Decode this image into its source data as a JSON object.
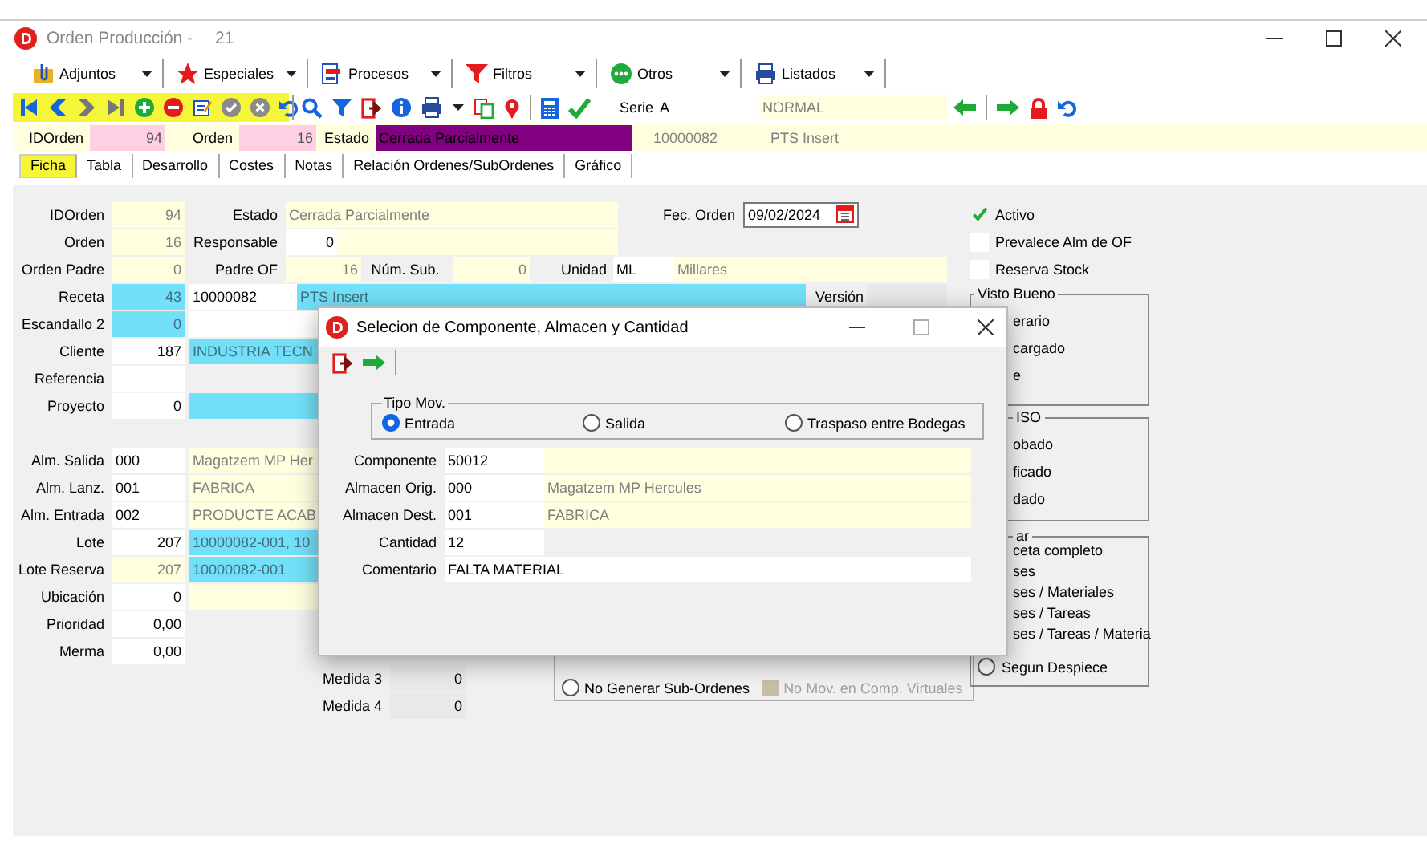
{
  "window": {
    "title": "Orden Producción -",
    "number": "21"
  },
  "menu_toolbar": [
    {
      "label": "Adjuntos"
    },
    {
      "label": "Especiales"
    },
    {
      "label": "Procesos"
    },
    {
      "label": "Filtros"
    },
    {
      "label": "Otros"
    },
    {
      "label": "Listados"
    }
  ],
  "serie": {
    "label": "Serie",
    "value": "A",
    "description": "NORMAL"
  },
  "header": [
    {
      "kind": "label",
      "text": "IDOrden"
    },
    {
      "kind": "key",
      "text": "94"
    },
    {
      "kind": "label",
      "text": "Orden"
    },
    {
      "kind": "key",
      "text": "16"
    },
    {
      "kind": "label",
      "text": "Estado"
    },
    {
      "kind": "status",
      "text": "Cerrada Parcialmente",
      "color": "#800080"
    },
    {
      "kind": "readonly",
      "text": "10000082"
    },
    {
      "kind": "readonly",
      "text": "PTS Insert"
    }
  ],
  "tabs": [
    {
      "label": "Ficha",
      "selected": true
    },
    {
      "label": "Tabla",
      "selected": false
    },
    {
      "label": "Desarrollo",
      "selected": false
    },
    {
      "label": "Costes",
      "selected": false
    },
    {
      "label": "Notas",
      "selected": false
    },
    {
      "label": "Relación Ordenes/SubOrdenes",
      "selected": false
    },
    {
      "label": "Gráfico",
      "selected": false
    }
  ],
  "form_rows": [
    [
      {
        "kind": "label",
        "text": "IDOrden"
      },
      {
        "kind": "readonly",
        "text": "94"
      },
      {
        "kind": "label",
        "text": "Estado"
      },
      {
        "kind": "readonly",
        "text": "Cerrada Parcialmente"
      },
      {
        "kind": "label",
        "text": "Fec. Orden"
      },
      {
        "kind": "date",
        "text": "09/02/2024"
      }
    ],
    [
      {
        "kind": "label",
        "text": "Orden"
      },
      {
        "kind": "readonly",
        "text": "16"
      },
      {
        "kind": "label",
        "text": "Responsable"
      },
      {
        "kind": "input",
        "text": "0"
      },
      {
        "kind": "readonly"
      }
    ],
    [
      {
        "kind": "label",
        "text": "Orden Padre"
      },
      {
        "kind": "readonly",
        "text": "0"
      },
      {
        "kind": "label",
        "text": "Padre OF"
      },
      {
        "kind": "readonly",
        "text": "16"
      },
      {
        "kind": "label",
        "text": "Núm. Sub."
      },
      {
        "kind": "readonly",
        "text": "0"
      },
      {
        "kind": "label",
        "text": "Unidad"
      },
      {
        "kind": "input",
        "text": "ML"
      },
      {
        "kind": "readonly",
        "text": "Millares"
      }
    ],
    [
      {
        "kind": "label",
        "text": "Receta"
      },
      {
        "kind": "link",
        "text": "43"
      },
      {
        "kind": "input",
        "text": "10000082"
      },
      {
        "kind": "link",
        "text": "PTS Insert"
      },
      {
        "kind": "label",
        "text": "Versión"
      },
      {
        "kind": "disabled"
      }
    ],
    [
      {
        "kind": "label",
        "text": "Escandallo 2"
      },
      {
        "kind": "link",
        "text": "0"
      },
      {
        "kind": "input"
      }
    ],
    [
      {
        "kind": "label",
        "text": "Cliente"
      },
      {
        "kind": "input",
        "text": "187"
      },
      {
        "kind": "link",
        "text": "INDUSTRIA TECN"
      }
    ],
    [
      {
        "kind": "label",
        "text": "Referencia"
      },
      {
        "kind": "input"
      }
    ],
    [
      {
        "kind": "label",
        "text": "Proyecto"
      },
      {
        "kind": "input",
        "text": "0"
      },
      {
        "kind": "link"
      }
    ],
    [],
    [
      {
        "kind": "label",
        "text": "Alm. Salida"
      },
      {
        "kind": "input",
        "text": "000"
      },
      {
        "kind": "readonly",
        "text": "Magatzem MP Her"
      }
    ],
    [
      {
        "kind": "label",
        "text": "Alm. Lanz."
      },
      {
        "kind": "input",
        "text": "001"
      },
      {
        "kind": "readonly",
        "text": "FABRICA"
      }
    ],
    [
      {
        "kind": "label",
        "text": "Alm. Entrada"
      },
      {
        "kind": "input",
        "text": "002"
      },
      {
        "kind": "readonly",
        "text": "PRODUCTE ACAB"
      }
    ],
    [
      {
        "kind": "label",
        "text": "Lote"
      },
      {
        "kind": "input",
        "text": "207"
      },
      {
        "kind": "link",
        "text": "10000082-001, 10"
      }
    ],
    [
      {
        "kind": "label",
        "text": "Lote Reserva"
      },
      {
        "kind": "readonly",
        "text": "207"
      },
      {
        "kind": "link",
        "text": "10000082-001"
      }
    ],
    [
      {
        "kind": "label",
        "text": "Ubicación"
      },
      {
        "kind": "input",
        "text": "0"
      },
      {
        "kind": "readonly"
      }
    ],
    [
      {
        "kind": "label",
        "text": "Prioridad"
      },
      {
        "kind": "input",
        "text": "0,00"
      }
    ],
    [
      {
        "kind": "label",
        "text": "Merma"
      },
      {
        "kind": "input",
        "text": "0,00"
      }
    ],
    [
      {
        "kind": "label",
        "text": "Medida 3"
      },
      {
        "kind": "disabled",
        "text": "0"
      }
    ],
    [
      {
        "kind": "label",
        "text": "Medida 4"
      },
      {
        "kind": "disabled",
        "text": "0"
      }
    ]
  ],
  "options": [
    {
      "label": "Activo",
      "checked": true
    },
    {
      "label": "Prevalece Alm de OF",
      "checked": false
    },
    {
      "label": "Reserva Stock",
      "checked": false
    }
  ],
  "groups": [
    {
      "title": "Visto Bueno",
      "items": [
        "erario",
        "cargado",
        "e"
      ]
    },
    {
      "title": "ISO",
      "items": [
        "obado",
        "ficado",
        "dado"
      ]
    },
    {
      "title": "ar",
      "items": [
        "ceta completo",
        "ses",
        "ses / Materiales",
        "ses / Tareas",
        "ses / Tareas / Materia"
      ],
      "option": {
        "label": "Segun Despiece",
        "selected": false
      }
    }
  ],
  "sub_orders": {
    "option": {
      "label": "No Generar Sub-Ordenes",
      "selected": false
    },
    "virtual": {
      "label": "No Mov. en Comp. Virtuales",
      "checked": false,
      "disabled": true
    }
  },
  "dialog": {
    "title": "Selecion de Componente, Almacen y Cantidad",
    "group_title": "Tipo Mov.",
    "movement_types": [
      {
        "label": "Entrada",
        "selected": true
      },
      {
        "label": "Salida",
        "selected": false
      },
      {
        "label": "Traspaso entre Bodegas",
        "selected": false
      }
    ],
    "fields": [
      {
        "label": "Componente",
        "value": "50012",
        "description": {
          "kind": "readonly"
        }
      },
      {
        "label": "Almacen Orig.",
        "value": "000",
        "description": {
          "kind": "readonly",
          "text": "Magatzem MP Hercules"
        }
      },
      {
        "label": "Almacen Dest.",
        "value": "001",
        "description": {
          "kind": "readonly",
          "text": "FABRICA"
        }
      },
      {
        "label": "Cantidad",
        "value": "12"
      },
      {
        "label": "Comentario",
        "value": "FALTA MATERIAL",
        "wide": true
      }
    ]
  }
}
